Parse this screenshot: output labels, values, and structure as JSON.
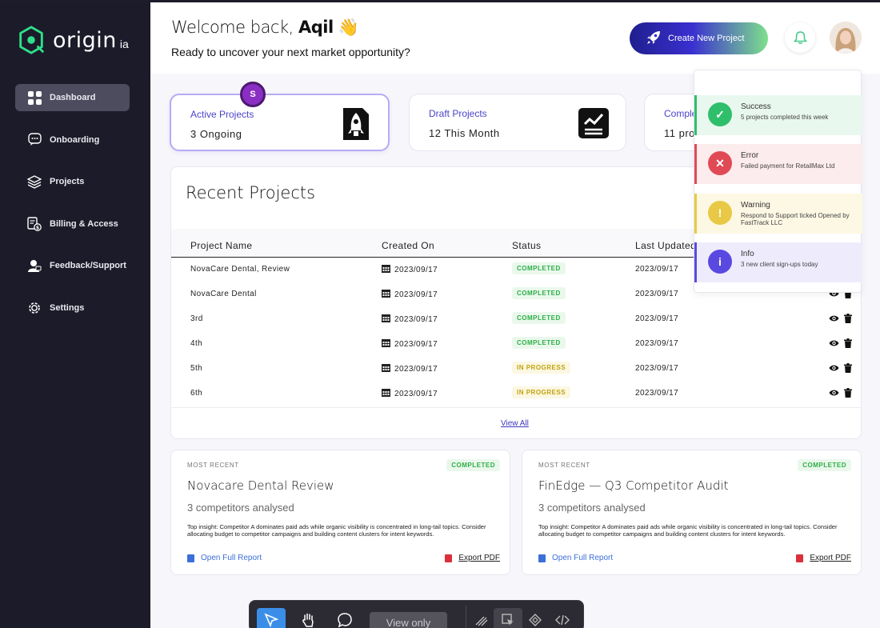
{
  "brand": {
    "name": "origin",
    "sub": "ia"
  },
  "sidebar": {
    "items": [
      {
        "label": "Dashboard",
        "icon": "dashboard-grid-icon",
        "active": true
      },
      {
        "label": "Onboarding",
        "icon": "chat-bubble-icon"
      },
      {
        "label": "Projects",
        "icon": "layers-icon"
      },
      {
        "label": "Billing & Access",
        "icon": "billing-icon"
      },
      {
        "label": "Feedback/Support",
        "icon": "support-agent-icon"
      },
      {
        "label": "Settings",
        "icon": "gear-icon"
      }
    ]
  },
  "header": {
    "greeting_prefix": "Welcome back,",
    "user_name": "Aqil",
    "wave_emoji": "👋",
    "subtitle": "Ready to uncover your next market opportunity?",
    "create_button": "Create New Project"
  },
  "stats": [
    {
      "title": "Active Projects",
      "value": "3 Ongoing"
    },
    {
      "title": "Draft Projects",
      "value": "12 This Month"
    },
    {
      "title": "Comple",
      "value": "11 proj"
    }
  ],
  "badge_initial": "S",
  "recent": {
    "title": "Recent Projects",
    "columns": [
      "Project Name",
      "Created On",
      "Status",
      "Last Updated"
    ],
    "rows": [
      {
        "name": "NovaCare Dental, Review",
        "created": "2023/09/17",
        "status": "COMPLETED",
        "updated": "2023/09/17"
      },
      {
        "name": "NovaCare Dental",
        "created": "2023/09/17",
        "status": "COMPLETED",
        "updated": "2023/09/17"
      },
      {
        "name": "3rd",
        "created": "2023/09/17",
        "status": "COMPLETED",
        "updated": "2023/09/17"
      },
      {
        "name": "4th",
        "created": "2023/09/17",
        "status": "COMPLETED",
        "updated": "2023/09/17"
      },
      {
        "name": "5th",
        "created": "2023/09/17",
        "status": "IN PROGRESS",
        "updated": "2023/09/17"
      },
      {
        "name": "6th",
        "created": "2023/09/17",
        "status": "IN PROGRESS",
        "updated": "2023/09/17"
      }
    ],
    "view_all": "View All"
  },
  "recent_cards": [
    {
      "label": "MOST RECENT",
      "status": "COMPLETED",
      "title": "Novacare Dental Review",
      "competitors": "3 competitors analysed",
      "insight": "Top insight: Competitor A dominates paid ads while organic visibility is concentrated in long-tail topics. Consider allocating budget to competitor campaigns and building content clusters for intent keywords.",
      "open": "Open Full Report",
      "export": "Export PDF"
    },
    {
      "label": "MOST RECENT",
      "status": "COMPLETED",
      "title": "FinEdge — Q3 Competitor Audit",
      "competitors": "3 competitors analysed",
      "insight": "Top insight: Competitor A dominates paid ads while organic visibility is concentrated in long-tail topics. Consider allocating budget to competitor campaigns and building content clusters for intent keywords.",
      "open": "Open Full Report",
      "export": "Export PDF"
    }
  ],
  "notifications": [
    {
      "title": "Success",
      "message": "5 projects completed this week",
      "type": "success",
      "color": "#2fbf6b",
      "bg": "#e9f8ef",
      "icon": "check-icon"
    },
    {
      "title": "Error",
      "message": "Failed payment for RetailMax Ltd",
      "type": "error",
      "color": "#e04a55",
      "bg": "#fdecee",
      "icon": "close-icon"
    },
    {
      "title": "Warning",
      "message": "Respond to Support ticked Opened by FastTrack LLC",
      "type": "warning",
      "color": "#e9c845",
      "bg": "#fdf8e4",
      "icon": "exclamation-icon"
    },
    {
      "title": "Info",
      "message": "3 new client sign-ups today",
      "type": "info",
      "color": "#5a49e0",
      "bg": "#eeecfc",
      "icon": "info-icon"
    }
  ],
  "toolbar": {
    "view_only": "View only"
  },
  "colors": {
    "sidebar": "#1c1b29",
    "accent": "#4a44c8",
    "completed": "#2cae46",
    "in_progress": "#c2a30e"
  }
}
